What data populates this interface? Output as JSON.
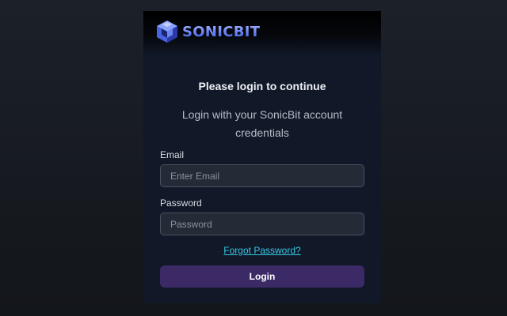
{
  "brand": {
    "name": "SONICBIT",
    "logo_icon": "sonicbit-cube-logo-icon",
    "color": "#5b7cf0"
  },
  "login": {
    "title": "Please login to continue",
    "subtitle": "Login with your SonicBit account credentials",
    "email_label": "Email",
    "email_placeholder": "Enter Email",
    "email_value": "",
    "password_label": "Password",
    "password_placeholder": "Password",
    "password_value": "",
    "forgot_link": "Forgot Password?",
    "submit_label": "Login"
  },
  "colors": {
    "page_bg": "#1c2029",
    "panel_bg": "#111827",
    "button_bg": "#3b2a66",
    "link": "#38c8e8"
  }
}
